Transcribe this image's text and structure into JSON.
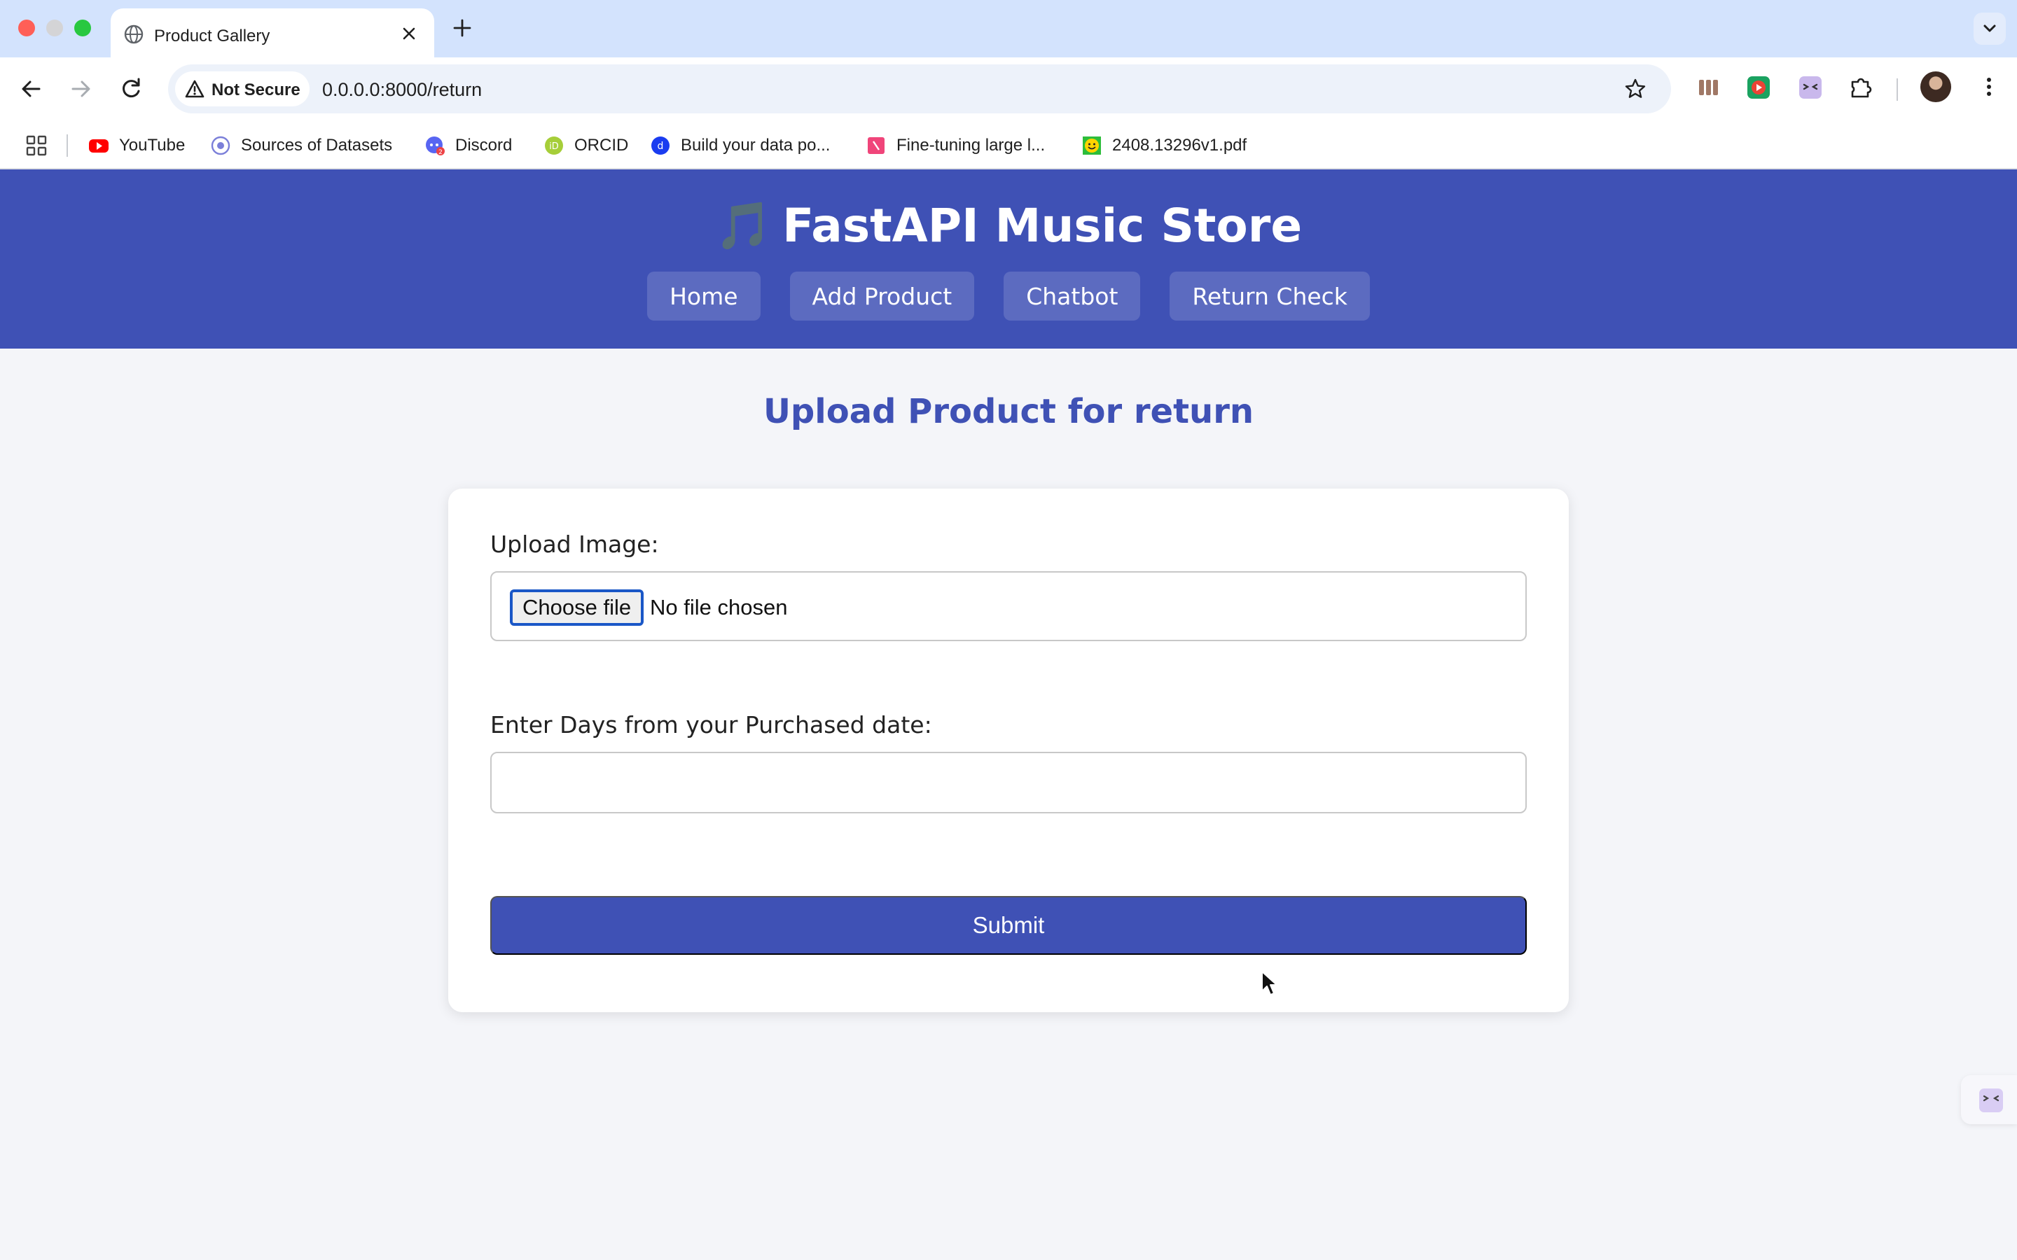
{
  "browser": {
    "tab_title": "Product Gallery",
    "security_label": "Not Secure",
    "url": "0.0.0.0:8000/return",
    "bookmarks": [
      {
        "label": "YouTube",
        "icon": "youtube-icon",
        "color": "#ff0000"
      },
      {
        "label": "Sources of Datasets",
        "icon": "datasets-icon",
        "color": "#7b7fd9"
      },
      {
        "label": "Discord",
        "icon": "discord-icon",
        "color": "#5865f2"
      },
      {
        "label": "ORCID",
        "icon": "orcid-icon",
        "color": "#a6ce39"
      },
      {
        "label": "Build your data po...",
        "icon": "data-icon",
        "color": "#1a3cf0"
      },
      {
        "label": "Fine-tuning large l...",
        "icon": "document-icon",
        "color": "#f0457a"
      },
      {
        "label": "2408.13296v1.pdf",
        "icon": "smiley-icon",
        "color": "#2dbd3a"
      }
    ]
  },
  "site": {
    "title": "FastAPI Music Store",
    "title_icon": "🎵",
    "nav": [
      "Home",
      "Add Product",
      "Chatbot",
      "Return Check"
    ],
    "brand_color": "#3f51b5"
  },
  "page": {
    "heading": "Upload Product for return",
    "upload_label": "Upload Image:",
    "choose_file_label": "Choose file",
    "no_file_text": "No file chosen",
    "days_label": "Enter Days from your Purchased date:",
    "days_value": "",
    "submit_label": "Submit"
  }
}
